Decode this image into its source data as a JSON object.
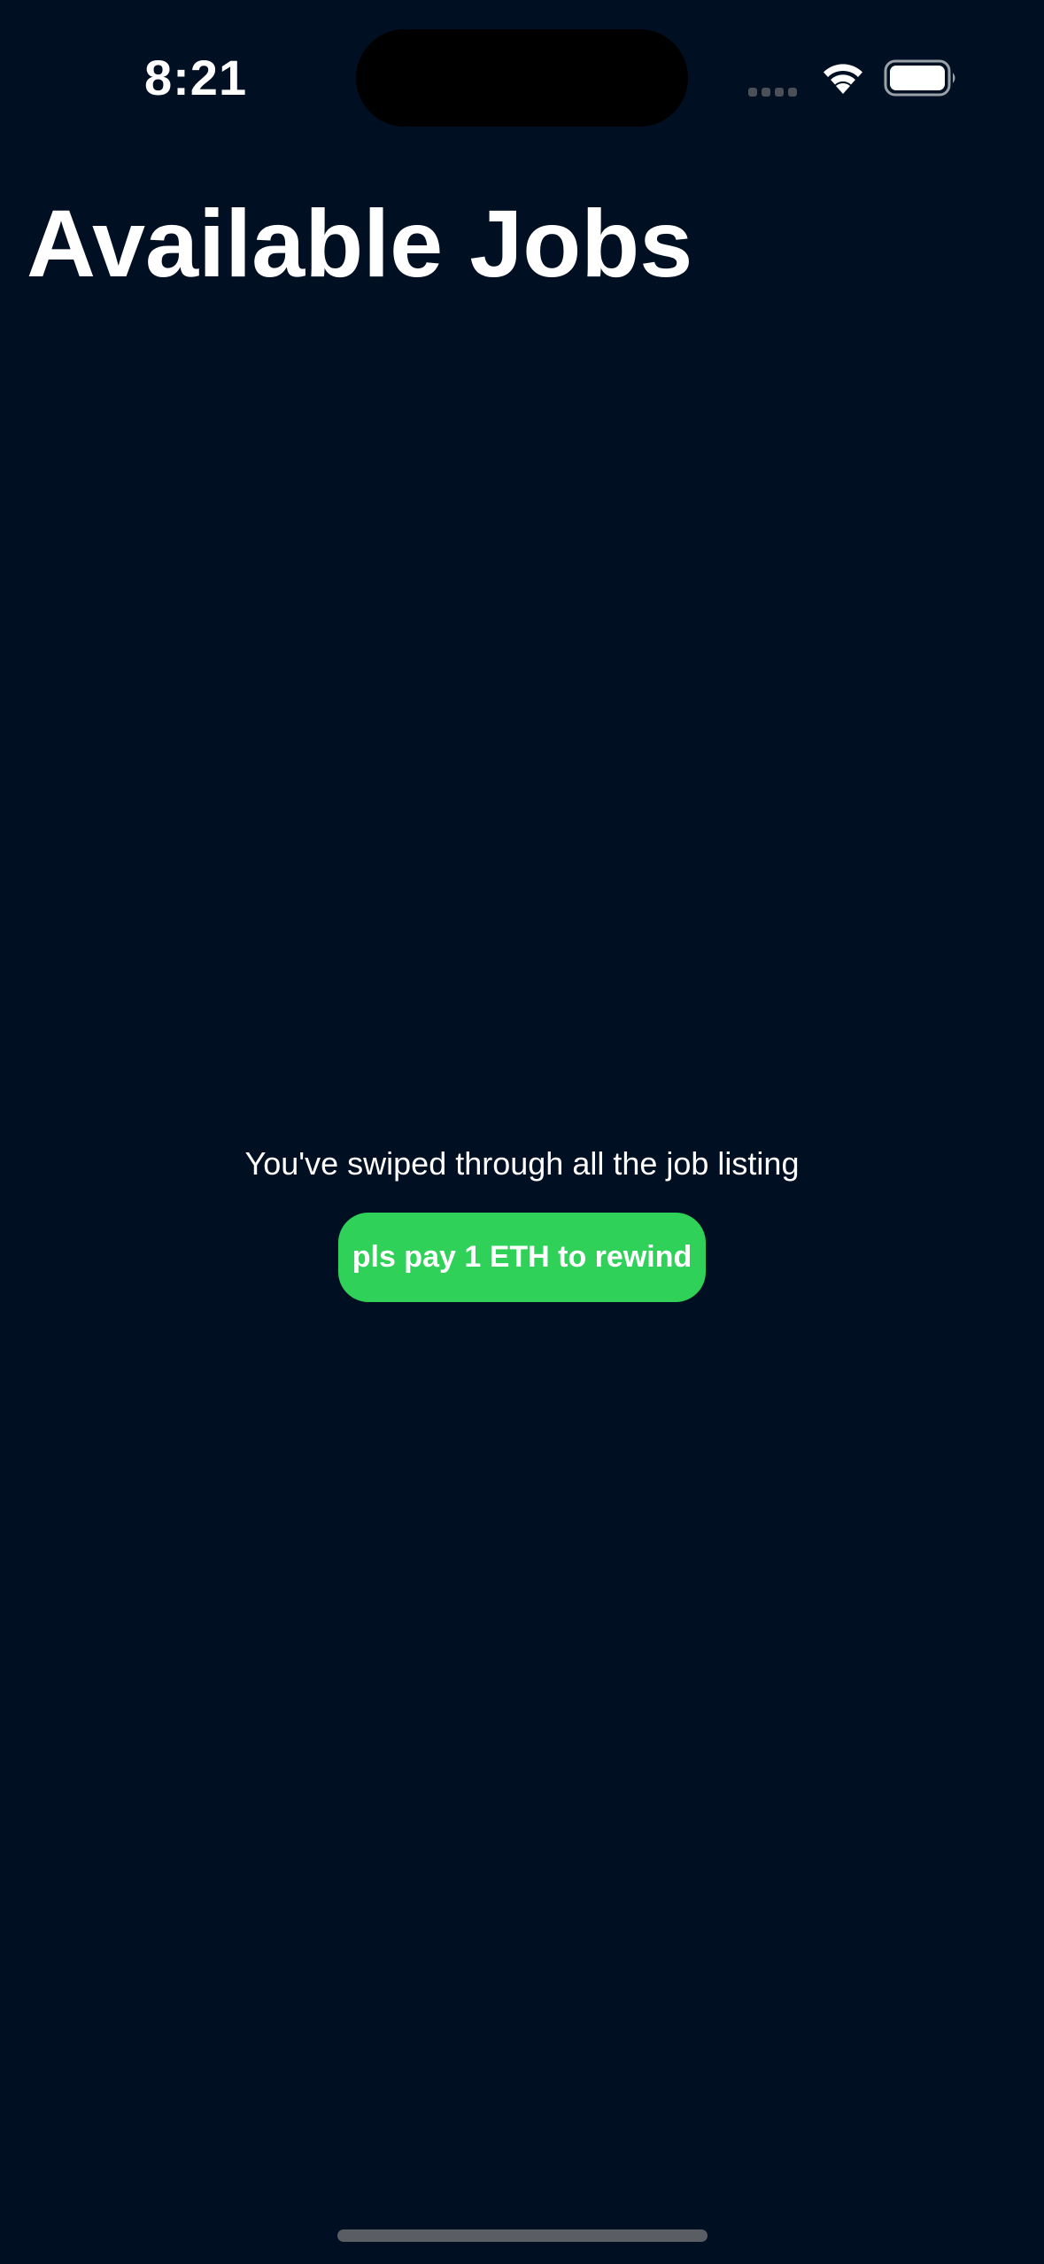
{
  "status_bar": {
    "time": "8:21",
    "icons": [
      "cellular-signal-icon",
      "wifi-icon",
      "battery-icon"
    ]
  },
  "header": {
    "title": "Available Jobs"
  },
  "main": {
    "empty_message": "You've swiped through all the job listing",
    "rewind_button_label": "pls pay 1 ETH to rewind"
  },
  "colors": {
    "background": "#000f21",
    "accent_green": "#2fd158",
    "text": "#ffffff"
  }
}
